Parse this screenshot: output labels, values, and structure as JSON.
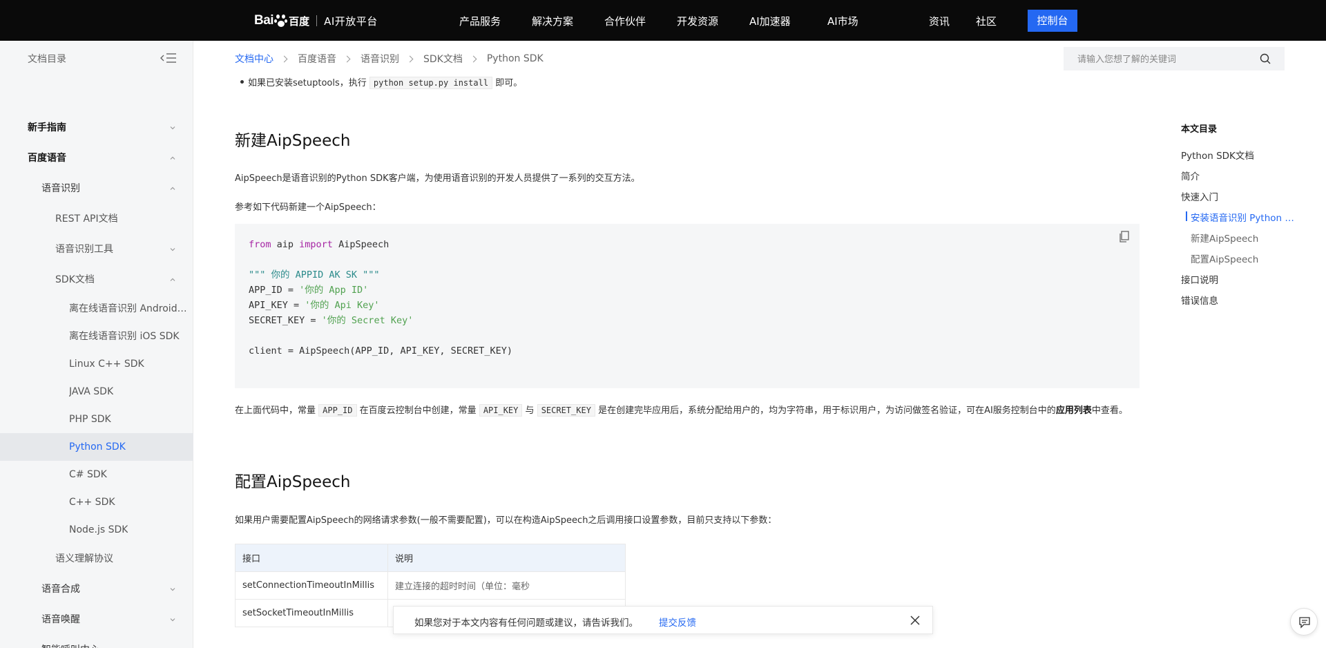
{
  "brand": {
    "logo_bai": "Bai",
    "logo_du": "百度",
    "platform": "AI开放平台"
  },
  "topnav": {
    "items": [
      "产品服务",
      "解决方案",
      "合作伙伴",
      "开发资源",
      "AI加速器",
      "AI市场",
      "资讯",
      "社区"
    ],
    "console_label": "控制台"
  },
  "sidebar": {
    "header": "文档目录",
    "items": [
      {
        "label": "新手指南"
      },
      {
        "label": "百度语音"
      },
      {
        "label": "语音识别"
      },
      {
        "label": "REST API文档"
      },
      {
        "label": "语音识别工具"
      },
      {
        "label": "SDK文档"
      },
      {
        "label": "离在线语音识别 Android SDK"
      },
      {
        "label": "离在线语音识别 iOS SDK"
      },
      {
        "label": "Linux C++ SDK"
      },
      {
        "label": "JAVA SDK"
      },
      {
        "label": "PHP SDK"
      },
      {
        "label": "Python SDK"
      },
      {
        "label": "C# SDK"
      },
      {
        "label": "C++ SDK"
      },
      {
        "label": "Node.js SDK"
      },
      {
        "label": "语义理解协议"
      },
      {
        "label": "语音合成"
      },
      {
        "label": "语音唤醒"
      },
      {
        "label": "智能呼叫中心"
      }
    ]
  },
  "breadcrumb": [
    "文档中心",
    "百度语音",
    "语音识别",
    "SDK文档",
    "Python SDK"
  ],
  "search": {
    "placeholder": "请输入您想了解的关键词"
  },
  "content": {
    "install_prefix": "如果已安装setuptools，执行",
    "install_code": "python setup.py install",
    "install_suffix": "即可。",
    "h_new": "新建AipSpeech",
    "p_new_1": "AipSpeech是语音识别的Python SDK客户端，为使用语音识别的开发人员提供了一系列的交互方法。",
    "p_new_2": "参考如下代码新建一个AipSpeech：",
    "code": {
      "l1_kw1": "from",
      "l1_mod": " aip ",
      "l1_kw2": "import",
      "l1_cls": " AipSpeech",
      "l3": "\"\"\" 你的 APPID AK SK \"\"\"",
      "l4_var": "APP_ID = ",
      "l4_val": "'你的 App ID'",
      "l5_var": "API_KEY = ",
      "l5_val": "'你的 Api Key'",
      "l6_var": "SECRET_KEY = ",
      "l6_val": "'你的 Secret Key'",
      "l8": "client = AipSpeech(APP_ID, API_KEY, SECRET_KEY)"
    },
    "desc_1": "在上面代码中，常量",
    "desc_code_1": "APP_ID",
    "desc_2": "在百度云控制台中创建，常量",
    "desc_code_2": "API_KEY",
    "desc_3": "与",
    "desc_code_3": "SECRET_KEY",
    "desc_4": "是在创建完毕应用后，系统分配给用户的，均为字符串，用于标识用户，为访问做签名验证，可在AI服务控制台中的",
    "desc_bold": "应用列表",
    "desc_5": "中查看。",
    "h_config": "配置AipSpeech",
    "p_config": "如果用户需要配置AipSpeech的网络请求参数(一般不需要配置)，可以在构造AipSpeech之后调用接口设置参数，目前只支持以下参数：",
    "table": {
      "headers": [
        "接口",
        "说明"
      ],
      "rows": [
        [
          "setConnectionTimeoutInMillis",
          "建立连接的超时时间（单位：毫秒"
        ],
        [
          "setSocketTimeoutInMillis",
          ""
        ]
      ]
    }
  },
  "toc": {
    "title": "本文目录",
    "items": [
      "Python SDK文档",
      "简介",
      "快速入门",
      "安装语音识别 Python SDK",
      "新建AipSpeech",
      "配置AipSpeech",
      "接口说明",
      "错误信息"
    ]
  },
  "feedback": {
    "text": "如果您对于本文内容有任何问题或建议，请告诉我们。",
    "link": "提交反馈"
  },
  "colors": {
    "accent": "#2468f2",
    "topnav_bg": "#0a0a0a",
    "sidebar_bg": "#f5f6f7"
  }
}
